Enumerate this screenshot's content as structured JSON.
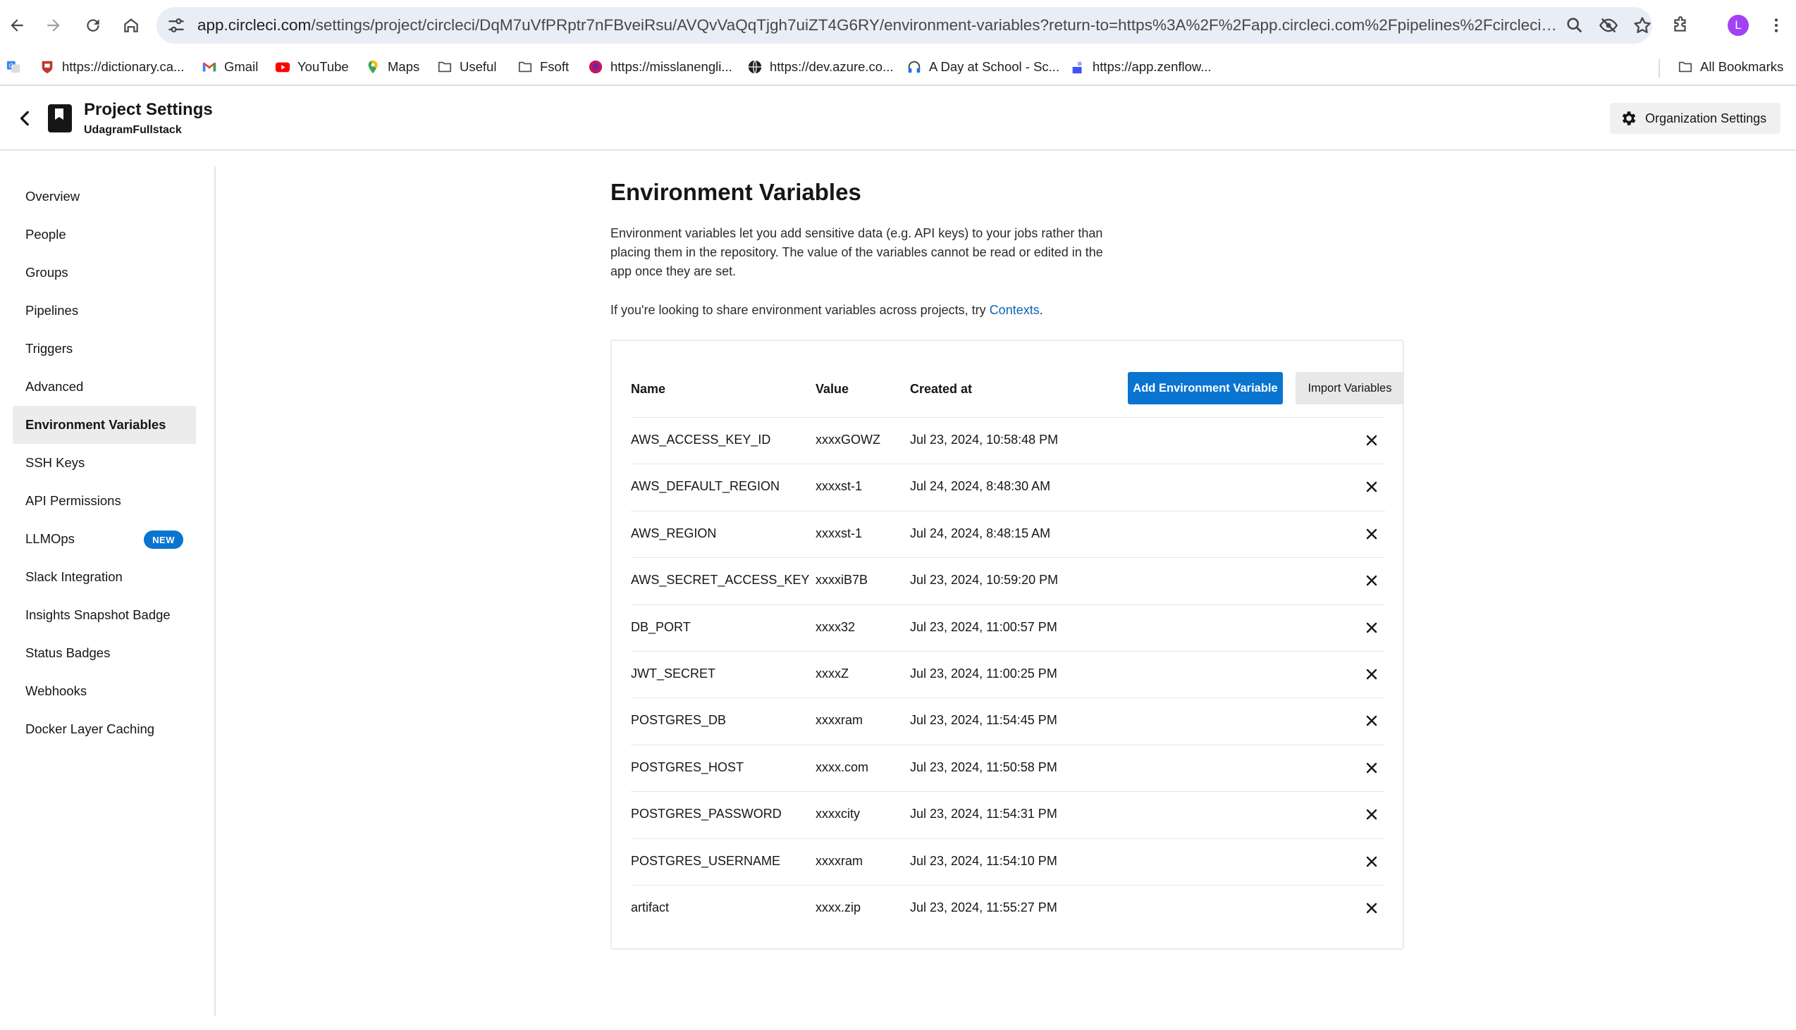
{
  "browser": {
    "url_host": "app.circleci.com",
    "url_rest": "/settings/project/circleci/DqM7uVfPRptr7nFBveiRsu/AVQvVaQqTjgh7uiZT4G6RY/environment-variables?return-to=https%3A%2F%2Fapp.circleci.com%2Fpipelines%2Fcircleci%2FDqM7uVfP...",
    "avatar_letter": "L",
    "bookmarks": [
      {
        "label": "https://dictionary.ca...",
        "icon": "cambridge-icon"
      },
      {
        "label": "Gmail",
        "icon": "gmail-icon"
      },
      {
        "label": "YouTube",
        "icon": "youtube-icon"
      },
      {
        "label": "Maps",
        "icon": "maps-icon"
      },
      {
        "label": "Useful",
        "icon": "folder-icon"
      },
      {
        "label": "Fsoft",
        "icon": "folder-icon"
      },
      {
        "label": "https://misslanengli...",
        "icon": "site-icon"
      },
      {
        "label": "https://dev.azure.co...",
        "icon": "globe-icon"
      },
      {
        "label": "A Day at School - Sc...",
        "icon": "headphones-icon"
      },
      {
        "label": "https://app.zenflow...",
        "icon": "zenflow-icon"
      }
    ],
    "all_bookmarks": "All Bookmarks"
  },
  "header": {
    "title": "Project Settings",
    "subtitle": "UdagramFullstack",
    "org_settings": "Organization Settings"
  },
  "sidebar": {
    "items": [
      {
        "label": "Overview"
      },
      {
        "label": "People"
      },
      {
        "label": "Groups"
      },
      {
        "label": "Pipelines"
      },
      {
        "label": "Triggers"
      },
      {
        "label": "Advanced"
      },
      {
        "label": "Environment Variables",
        "active": true
      },
      {
        "label": "SSH Keys"
      },
      {
        "label": "API Permissions"
      },
      {
        "label": "LLMOps",
        "badge": "NEW"
      },
      {
        "label": "Slack Integration"
      },
      {
        "label": "Insights Snapshot Badge"
      },
      {
        "label": "Status Badges"
      },
      {
        "label": "Webhooks"
      },
      {
        "label": "Docker Layer Caching"
      }
    ]
  },
  "main": {
    "title": "Environment Variables",
    "description": "Environment variables let you add sensitive data (e.g. API keys) to your jobs rather than placing them in the repository. The value of the variables cannot be read or edited in the app once they are set.",
    "contexts_prefix": "If you're looking to share environment variables across projects, try ",
    "contexts_link": "Contexts",
    "contexts_suffix": ".",
    "table": {
      "headers": {
        "name": "Name",
        "value": "Value",
        "created": "Created at"
      },
      "add_button": "Add Environment Variable",
      "import_button": "Import Variables",
      "rows": [
        {
          "name": "AWS_ACCESS_KEY_ID",
          "value": "xxxxGOWZ",
          "created": "Jul 23, 2024, 10:58:48 PM"
        },
        {
          "name": "AWS_DEFAULT_REGION",
          "value": "xxxxst-1",
          "created": "Jul 24, 2024, 8:48:30 AM"
        },
        {
          "name": "AWS_REGION",
          "value": "xxxxst-1",
          "created": "Jul 24, 2024, 8:48:15 AM"
        },
        {
          "name": "AWS_SECRET_ACCESS_KEY",
          "value": "xxxxiB7B",
          "created": "Jul 23, 2024, 10:59:20 PM"
        },
        {
          "name": "DB_PORT",
          "value": "xxxx32",
          "created": "Jul 23, 2024, 11:00:57 PM"
        },
        {
          "name": "JWT_SECRET",
          "value": "xxxxZ",
          "created": "Jul 23, 2024, 11:00:25 PM"
        },
        {
          "name": "POSTGRES_DB",
          "value": "xxxxram",
          "created": "Jul 23, 2024, 11:54:45 PM"
        },
        {
          "name": "POSTGRES_HOST",
          "value": "xxxx.com",
          "created": "Jul 23, 2024, 11:50:58 PM"
        },
        {
          "name": "POSTGRES_PASSWORD",
          "value": "xxxxcity",
          "created": "Jul 23, 2024, 11:54:31 PM"
        },
        {
          "name": "POSTGRES_USERNAME",
          "value": "xxxxram",
          "created": "Jul 23, 2024, 11:54:10 PM"
        },
        {
          "name": "artifact",
          "value": "xxxx.zip",
          "created": "Jul 23, 2024, 11:55:27 PM"
        }
      ]
    }
  },
  "colors": {
    "primary": "#0a74d1",
    "link": "#0a65b8",
    "active_bg": "#ececec",
    "omnibox_bg": "#e9eef6"
  }
}
